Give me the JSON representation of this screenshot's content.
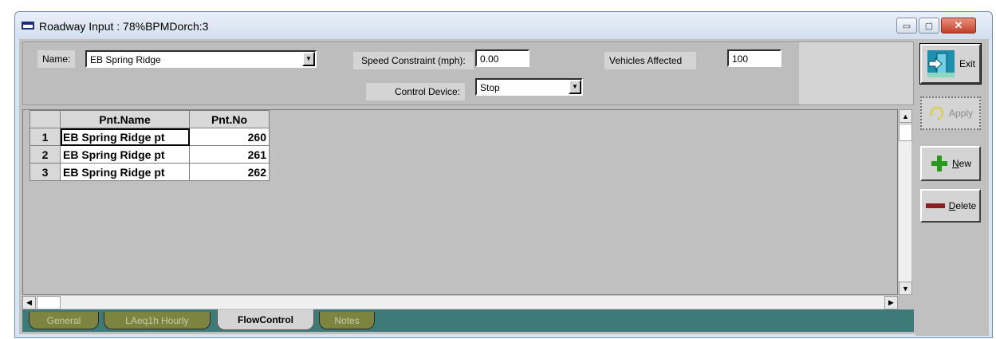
{
  "window": {
    "title": "Roadway Input : 78%BPMDorch:3",
    "controls": {
      "minimize": "▭",
      "maximize": "▢",
      "close": "✕"
    }
  },
  "form": {
    "name_label": "Name:",
    "name_value": "EB Spring Ridge",
    "speed_label": "Speed Constraint (mph):",
    "speed_value": "0.00",
    "vehicles_label": "Vehicles Affected",
    "vehicles_value": "100",
    "control_label": "Control Device:",
    "control_value": "Stop"
  },
  "grid": {
    "headers": [
      "Pnt.Name",
      "Pnt.No"
    ],
    "rows": [
      {
        "num": "1",
        "name": "EB Spring Ridge pt",
        "no": "260"
      },
      {
        "num": "2",
        "name": "EB Spring Ridge pt",
        "no": "261"
      },
      {
        "num": "3",
        "name": "EB Spring Ridge pt",
        "no": "262"
      }
    ]
  },
  "tabs": [
    "General",
    "LAeq1h Hourly",
    "FlowControl",
    "Notes"
  ],
  "active_tab": "FlowControl",
  "buttons": {
    "exit": "Exit",
    "apply": "Apply",
    "new": "New",
    "delete": "Delete"
  },
  "icons": {
    "exit": "exit-door-icon",
    "apply": "apply-arrow-icon",
    "new": "plus-icon",
    "delete": "minus-icon",
    "combo": "chevron-down-icon"
  },
  "colors": {
    "tab_strip": "#3e7a78",
    "tab_inactive": "#7d8440",
    "new_green": "#2a9a1f",
    "delete_red": "#8b1f1f"
  }
}
